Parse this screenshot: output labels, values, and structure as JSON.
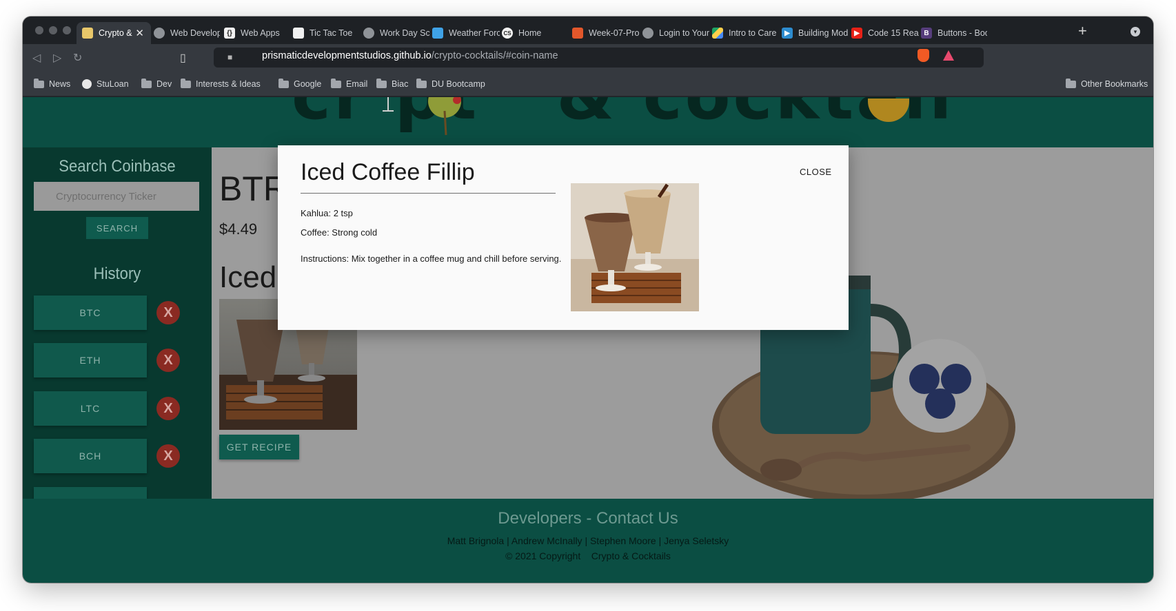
{
  "browser": {
    "tabs": [
      {
        "label": "Crypto &",
        "active": true
      },
      {
        "label": "Web Develop"
      },
      {
        "label": "Web Apps"
      },
      {
        "label": "Tic Tac Toe"
      },
      {
        "label": "Work Day Sc"
      },
      {
        "label": "Weather Forc"
      },
      {
        "label": "Home"
      },
      {
        "label": "Week-07-Pro"
      },
      {
        "label": "Login to Your"
      },
      {
        "label": "Intro to Care"
      },
      {
        "label": "Building Mod"
      },
      {
        "label": "Code 15 Rea"
      },
      {
        "label": "Buttons - Boo"
      }
    ],
    "url_host": "prismaticdevelopmentstudios.github.io",
    "url_path": "/crypto-cocktails/#coin-name",
    "bookmarks": [
      "News",
      "StuLoan",
      "Dev",
      "Interests & Ideas",
      "Google",
      "Email",
      "Biac",
      "DU Bootcamp"
    ],
    "other_bookmarks": "Other Bookmarks"
  },
  "sidebar": {
    "search_title": "Search Coinbase",
    "search_placeholder": "Cryptocurrency Ticker",
    "search_button": "SEARCH",
    "history_title": "History",
    "history": [
      {
        "ticker": "BTC",
        "delete": "X"
      },
      {
        "ticker": "ETH",
        "delete": "X"
      },
      {
        "ticker": "LTC",
        "delete": "X"
      },
      {
        "ticker": "BCH",
        "delete": "X"
      }
    ]
  },
  "main": {
    "symbol": "BTR",
    "price": "$4.49",
    "drink": "Iced",
    "recipe_button": "GET RECIPE"
  },
  "modal": {
    "title": "Iced Coffee Fillip",
    "ingredients": [
      "Kahlua: 2 tsp",
      "Coffee: Strong cold"
    ],
    "instructions": "Instructions: Mix together in a coffee mug and chill before serving.",
    "close": "CLOSE"
  },
  "footer": {
    "title": "Developers - Contact Us",
    "names": "Matt Brignola | Andrew McInally | Stephen Moore | Jenya Seletsky",
    "copyright": "© 2021 Copyright    Crypto & Cocktails"
  },
  "colors": {
    "brand_dark": "#0b4e43",
    "sidebar": "#08392f",
    "button": "#0f5b4e",
    "delete": "#8a2a22"
  }
}
